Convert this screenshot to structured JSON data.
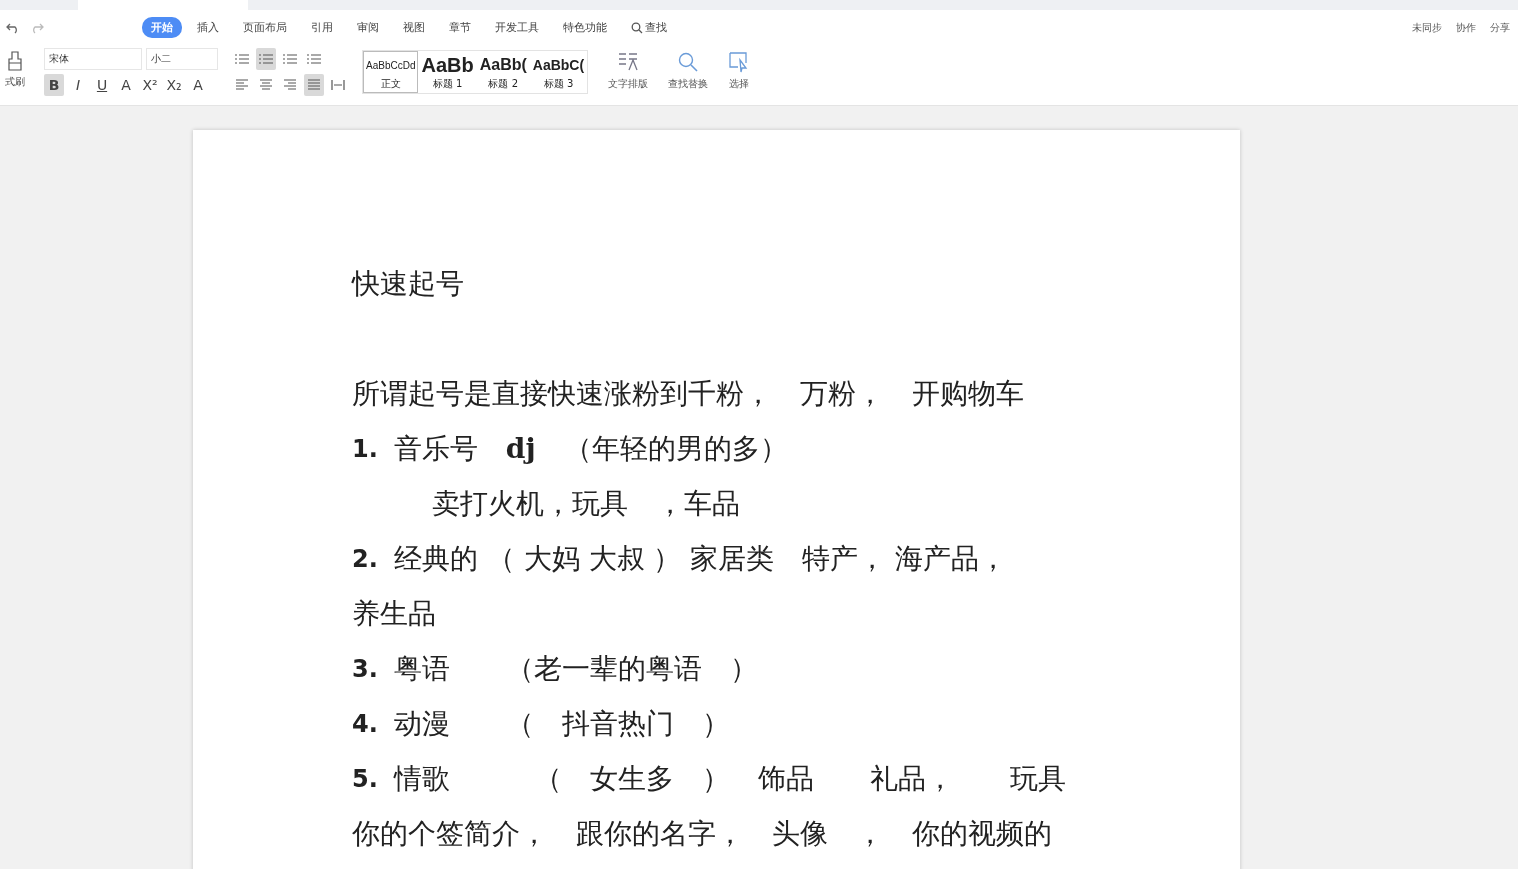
{
  "menu_tabs": [
    {
      "label": "开始",
      "selected": true
    },
    {
      "label": "插入",
      "selected": false
    },
    {
      "label": "页面布局",
      "selected": false
    },
    {
      "label": "引用",
      "selected": false
    },
    {
      "label": "审阅",
      "selected": false
    },
    {
      "label": "视图",
      "selected": false
    },
    {
      "label": "章节",
      "selected": false
    },
    {
      "label": "开发工具",
      "selected": false
    },
    {
      "label": "特色功能",
      "selected": false
    }
  ],
  "search": {
    "label": "查找"
  },
  "actions": [
    {
      "label": "未同步"
    },
    {
      "label": "协作"
    },
    {
      "label": "分享"
    }
  ],
  "format_painter": {
    "label": "式刷"
  },
  "font": {
    "name": "宋体",
    "size": "小二"
  },
  "char_buttons": [
    {
      "label": "B",
      "selected": true
    },
    {
      "label": "I",
      "selected": false
    },
    {
      "label": "U",
      "selected": false
    },
    {
      "label": "A",
      "selected": false
    },
    {
      "label": "X²",
      "selected": false
    },
    {
      "label": "X₂",
      "selected": false
    },
    {
      "label": "A",
      "selected": false
    }
  ],
  "list_buttons": [
    {
      "selected": false
    },
    {
      "selected": true
    },
    {
      "selected": false
    },
    {
      "selected": false
    }
  ],
  "align_buttons": [
    {
      "selected": false
    },
    {
      "selected": false
    },
    {
      "selected": false
    },
    {
      "selected": true
    },
    {
      "selected": false
    }
  ],
  "styles": [
    {
      "preview": "AaBbCcDd",
      "label": "正文",
      "selected": true
    },
    {
      "preview": "AaBb",
      "label": "标题 1",
      "selected": false
    },
    {
      "preview": "AaBb(",
      "label": "标题 2",
      "selected": false
    },
    {
      "preview": "AaBbC(",
      "label": "标题 3",
      "selected": false
    }
  ],
  "big_buttons": [
    {
      "label": "文字排版"
    },
    {
      "label": "查找替换"
    },
    {
      "label": "选择"
    }
  ],
  "document": [
    {
      "kind": "heading",
      "text": "快速起号"
    },
    {
      "kind": "blank"
    },
    {
      "kind": "para",
      "text": "所谓起号是直接快速涨粉到千粉，　万粉，　开购物车"
    },
    {
      "kind": "numbered",
      "number": "1.",
      "text": "音乐号　**dj**　（年轻的男的多）"
    },
    {
      "kind": "indent",
      "text": "卖打火机，玩具　，车品"
    },
    {
      "kind": "numbered",
      "number": "2.",
      "text": "经典的 （ 大妈 大叔 ） 家居类　特产， 海产品，"
    },
    {
      "kind": "para",
      "text": "养生品"
    },
    {
      "kind": "numbered",
      "number": "3.",
      "text": "粤语　　（老一辈的粤语　）"
    },
    {
      "kind": "numbered",
      "number": "4.",
      "text": "动漫　　（　抖音热门　）"
    },
    {
      "kind": "numbered",
      "number": "5.",
      "text": "情歌　　　（　女生多　）　饰品　　礼品，　　玩具"
    },
    {
      "kind": "para",
      "text": "你的个签简介，　跟你的名字，　头像　，　你的视频的"
    }
  ]
}
